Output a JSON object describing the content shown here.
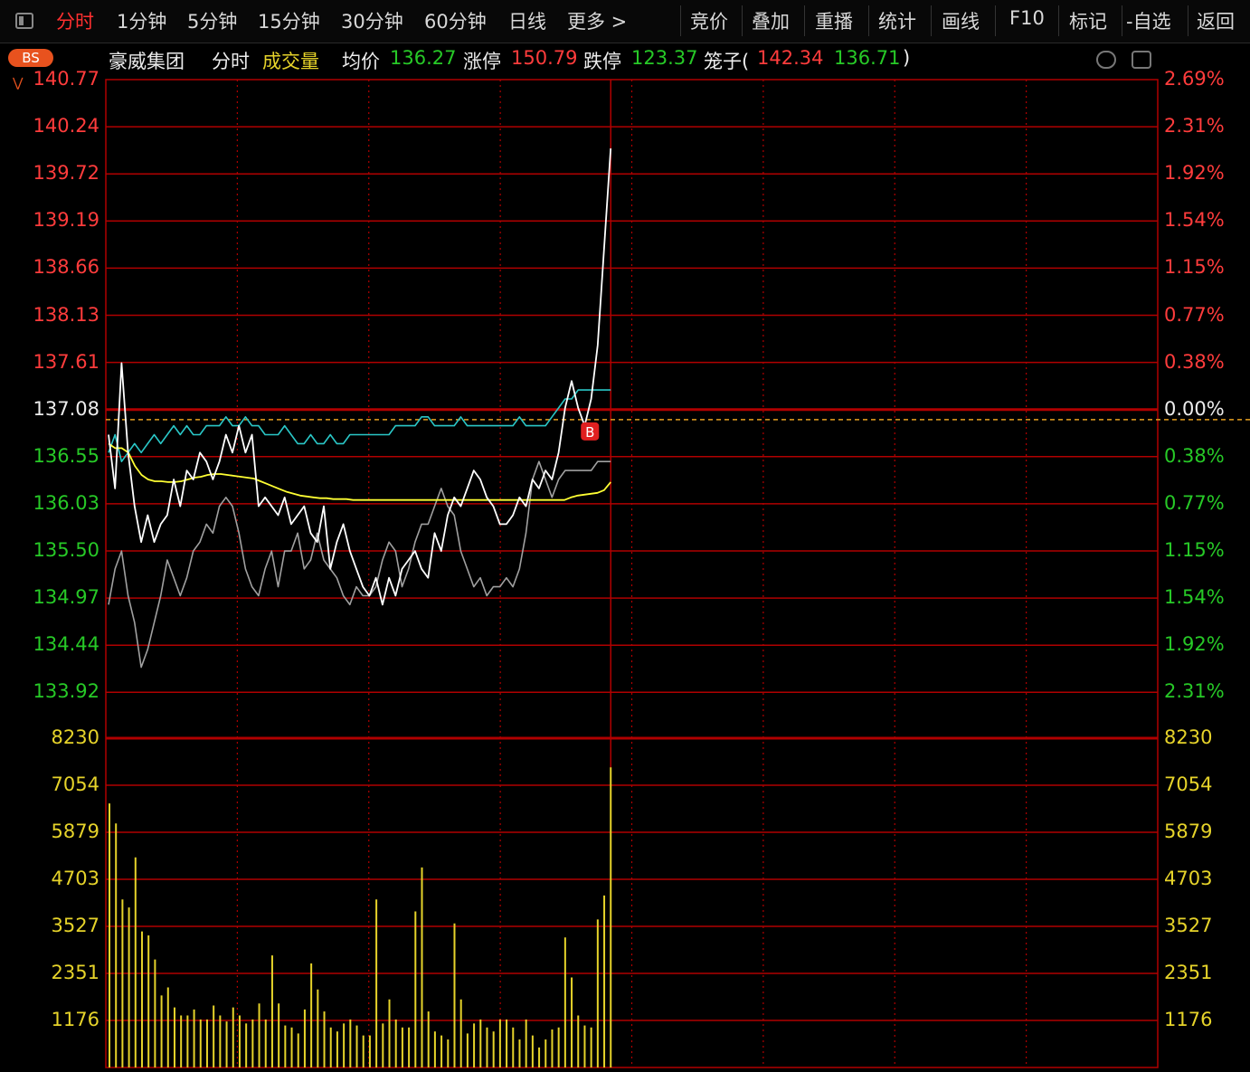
{
  "toolbar": {
    "tabs": [
      {
        "label": "分时",
        "active": true
      },
      {
        "label": "1分钟"
      },
      {
        "label": "5分钟"
      },
      {
        "label": "15分钟"
      },
      {
        "label": "30分钟"
      },
      {
        "label": "60分钟"
      },
      {
        "label": "日线"
      },
      {
        "label": "更多 >"
      }
    ],
    "actions": [
      "竞价",
      "叠加",
      "重播",
      "统计",
      "画线",
      "F10",
      "标记",
      "-自选",
      "返回"
    ]
  },
  "info": {
    "bs_badge": "BS",
    "stock_name": "豪威集团",
    "mode": "分时",
    "indicator": "成交量",
    "avg_label": "均价",
    "avg_value": "136.27",
    "limit_up_label": "涨停",
    "limit_up_value": "150.79",
    "limit_down_label": "跌停",
    "limit_down_value": "123.37",
    "cage_label": "笼子(",
    "cage_high": "142.34",
    "cage_low": "136.71",
    "cage_close": ")"
  },
  "price_axis": {
    "left": [
      "140.77",
      "140.24",
      "139.72",
      "139.19",
      "138.66",
      "138.13",
      "137.61",
      "137.08",
      "136.55",
      "136.03",
      "135.50",
      "134.97",
      "134.44",
      "133.92"
    ],
    "right": [
      "2.69%",
      "2.31%",
      "1.92%",
      "1.54%",
      "1.15%",
      "0.77%",
      "0.38%",
      "0.00%",
      "0.38%",
      "0.77%",
      "1.15%",
      "1.54%",
      "1.92%",
      "2.31%"
    ]
  },
  "volume_axis": {
    "labels": [
      "8230",
      "7054",
      "5879",
      "4703",
      "3527",
      "2351",
      "1176"
    ]
  },
  "marker": {
    "label": "B"
  },
  "colors": {
    "grid": "#b00000",
    "price_line": "#ffffff",
    "avg_line": "#ffff33",
    "compare_line": "#2ac7c7",
    "index_line": "#a0a0a0",
    "volume": "#e6d32a",
    "cage_dash": "#e6a020",
    "up": "#ff3c3c",
    "down": "#27c927"
  },
  "chart_data": {
    "type": "line",
    "prev_close": 137.08,
    "ylim": [
      133.92,
      140.77
    ],
    "volume_ylim": [
      0,
      8230
    ],
    "current_time_fraction": 0.48,
    "series": [
      {
        "name": "价格",
        "values": [
          136.8,
          136.2,
          137.6,
          136.6,
          136.0,
          135.6,
          135.9,
          135.6,
          135.8,
          135.9,
          136.3,
          136.0,
          136.4,
          136.3,
          136.6,
          136.5,
          136.3,
          136.5,
          136.8,
          136.6,
          136.9,
          136.6,
          136.8,
          136.0,
          136.1,
          136.0,
          135.9,
          136.1,
          135.8,
          135.9,
          136.0,
          135.7,
          135.6,
          136.0,
          135.3,
          135.6,
          135.8,
          135.5,
          135.3,
          135.1,
          135.0,
          135.2,
          134.9,
          135.2,
          135.0,
          135.3,
          135.4,
          135.5,
          135.3,
          135.2,
          135.7,
          135.5,
          135.9,
          136.1,
          136.0,
          136.2,
          136.4,
          136.3,
          136.1,
          136.0,
          135.8,
          135.8,
          135.9,
          136.1,
          136.0,
          136.3,
          136.2,
          136.4,
          136.3,
          136.6,
          137.1,
          137.4,
          137.1,
          136.9,
          137.2,
          137.8,
          138.9,
          140.0
        ]
      },
      {
        "name": "均价",
        "values": [
          136.7,
          136.65,
          136.65,
          136.6,
          136.45,
          136.35,
          136.3,
          136.28,
          136.28,
          136.27,
          136.27,
          136.28,
          136.3,
          136.32,
          136.33,
          136.35,
          136.36,
          136.36,
          136.35,
          136.34,
          136.33,
          136.32,
          136.31,
          136.28,
          136.25,
          136.22,
          136.19,
          136.16,
          136.14,
          136.12,
          136.11,
          136.1,
          136.09,
          136.09,
          136.08,
          136.08,
          136.08,
          136.07,
          136.07,
          136.07,
          136.07,
          136.07,
          136.07,
          136.07,
          136.07,
          136.07,
          136.07,
          136.07,
          136.07,
          136.07,
          136.07,
          136.07,
          136.07,
          136.07,
          136.07,
          136.07,
          136.07,
          136.07,
          136.07,
          136.07,
          136.07,
          136.07,
          136.07,
          136.07,
          136.07,
          136.07,
          136.07,
          136.07,
          136.07,
          136.07,
          136.1,
          136.12,
          136.13,
          136.14,
          136.15,
          136.18,
          136.27
        ]
      },
      {
        "name": "对比",
        "values": [
          136.6,
          136.8,
          136.5,
          136.6,
          136.7,
          136.6,
          136.7,
          136.8,
          136.7,
          136.8,
          136.9,
          136.8,
          136.9,
          136.8,
          136.8,
          136.9,
          136.9,
          136.9,
          137.0,
          136.9,
          136.9,
          137.0,
          136.9,
          136.9,
          136.8,
          136.8,
          136.8,
          136.9,
          136.8,
          136.7,
          136.7,
          136.8,
          136.7,
          136.7,
          136.8,
          136.7,
          136.7,
          136.8,
          136.8,
          136.8,
          136.8,
          136.8,
          136.8,
          136.8,
          136.9,
          136.9,
          136.9,
          136.9,
          137.0,
          137.0,
          136.9,
          136.9,
          136.9,
          136.9,
          137.0,
          136.9,
          136.9,
          136.9,
          136.9,
          136.9,
          136.9,
          136.9,
          136.9,
          137.0,
          136.9,
          136.9,
          136.9,
          136.9,
          137.0,
          137.1,
          137.2,
          137.2,
          137.3,
          137.3,
          137.3,
          137.3,
          137.3,
          137.3
        ]
      },
      {
        "name": "指数",
        "values": [
          134.9,
          135.3,
          135.5,
          135.0,
          134.7,
          134.2,
          134.4,
          134.7,
          135.0,
          135.4,
          135.2,
          135.0,
          135.2,
          135.5,
          135.6,
          135.8,
          135.7,
          136.0,
          136.1,
          136.0,
          135.7,
          135.3,
          135.1,
          135.0,
          135.3,
          135.5,
          135.1,
          135.5,
          135.5,
          135.7,
          135.3,
          135.4,
          135.7,
          135.4,
          135.3,
          135.2,
          135.0,
          134.9,
          135.1,
          135.0,
          135.0,
          135.1,
          135.4,
          135.6,
          135.5,
          135.1,
          135.3,
          135.6,
          135.8,
          135.8,
          136.0,
          136.2,
          136.0,
          135.9,
          135.5,
          135.3,
          135.1,
          135.2,
          135.0,
          135.1,
          135.1,
          135.2,
          135.1,
          135.3,
          135.7,
          136.3,
          136.5,
          136.3,
          136.1,
          136.3,
          136.4,
          136.4,
          136.4,
          136.4,
          136.4,
          136.5,
          136.5,
          136.5
        ]
      },
      {
        "name": "成交量",
        "values": [
          6600,
          6100,
          4200,
          4000,
          5250,
          3400,
          3300,
          2700,
          1800,
          2000,
          1500,
          1300,
          1300,
          1450,
          1200,
          1200,
          1550,
          1300,
          1150,
          1500,
          1300,
          1100,
          1200,
          1600,
          1200,
          2800,
          1600,
          1050,
          1000,
          850,
          1450,
          2600,
          1950,
          1400,
          1000,
          900,
          1100,
          1200,
          1050,
          800,
          800,
          4200,
          1100,
          1700,
          1200,
          1000,
          1000,
          3900,
          5000,
          1400,
          900,
          800,
          700,
          3600,
          1700,
          850,
          1100,
          1200,
          1000,
          900,
          1200,
          1200,
          1000,
          700,
          1200,
          800,
          500,
          700,
          950,
          1000,
          3250,
          2250,
          1300,
          1050,
          1000,
          3700,
          4300,
          7500
        ]
      }
    ]
  }
}
